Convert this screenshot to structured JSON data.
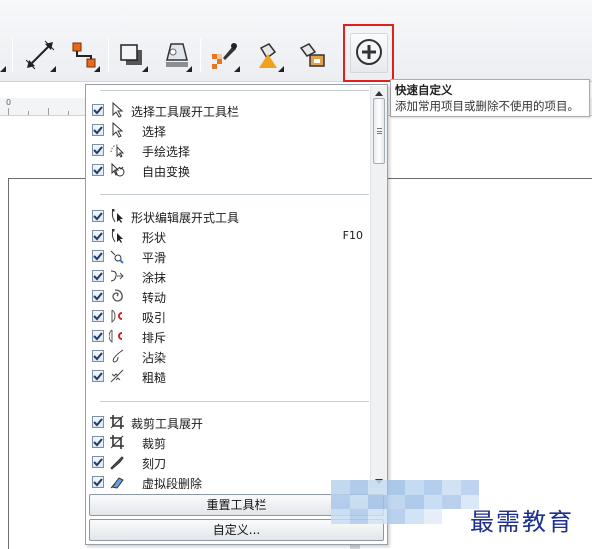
{
  "toolbar": {
    "buttons": [
      {
        "name": "tool-icon-partial",
        "icon": "partial-tool-icon"
      },
      {
        "name": "dimension-tool",
        "icon": "dimension-icon"
      },
      {
        "name": "connector-tool",
        "icon": "connector-icon"
      },
      {
        "name": "shadow-tool",
        "icon": "drop-shadow-icon"
      },
      {
        "name": "transparency-tool",
        "icon": "transparency-icon"
      },
      {
        "name": "color-eyedropper-tool",
        "icon": "eyedropper-icon"
      },
      {
        "name": "interactive-fill-tool",
        "icon": "fill-icon"
      },
      {
        "name": "smart-fill-tool",
        "icon": "smart-fill-icon"
      }
    ],
    "customize_button_icon": "plus-circle-icon"
  },
  "tooltip": {
    "title": "快速自定义",
    "description": "添加常用项目或删除不使用的项目。"
  },
  "ruler": {
    "label": "0"
  },
  "menu": {
    "groups": [
      {
        "label": "选择工具展开工具栏",
        "checked": true,
        "icon": "pick-arrow-icon",
        "items": [
          {
            "label": "选择",
            "checked": true,
            "icon": "pick-arrow-icon",
            "shortcut": ""
          },
          {
            "label": "手绘选择",
            "checked": true,
            "icon": "freehand-pick-icon",
            "shortcut": ""
          },
          {
            "label": "自由变换",
            "checked": true,
            "icon": "free-transform-icon",
            "shortcut": ""
          }
        ]
      },
      {
        "label": "形状编辑展开式工具",
        "checked": true,
        "icon": "shape-tool-icon",
        "items": [
          {
            "label": "形状",
            "checked": true,
            "icon": "shape-tool-icon",
            "shortcut": "F10"
          },
          {
            "label": "平滑",
            "checked": true,
            "icon": "smooth-icon",
            "shortcut": ""
          },
          {
            "label": "涂抹",
            "checked": true,
            "icon": "smear-icon",
            "shortcut": ""
          },
          {
            "label": "转动",
            "checked": true,
            "icon": "twirl-icon",
            "shortcut": ""
          },
          {
            "label": "吸引",
            "checked": true,
            "icon": "attract-icon",
            "shortcut": ""
          },
          {
            "label": "排斥",
            "checked": true,
            "icon": "repel-icon",
            "shortcut": ""
          },
          {
            "label": "沾染",
            "checked": true,
            "icon": "smudge-icon",
            "shortcut": ""
          },
          {
            "label": "粗糙",
            "checked": true,
            "icon": "roughen-icon",
            "shortcut": ""
          }
        ]
      },
      {
        "label": "裁剪工具展开",
        "checked": true,
        "icon": "crop-icon",
        "items": [
          {
            "label": "裁剪",
            "checked": true,
            "icon": "crop-icon",
            "shortcut": ""
          },
          {
            "label": "刻刀",
            "checked": true,
            "icon": "knife-icon",
            "shortcut": ""
          },
          {
            "label": "虚拟段删除",
            "checked": true,
            "icon": "virtual-segment-delete-icon",
            "shortcut": ""
          }
        ]
      }
    ],
    "reset_button": "重置工具栏",
    "customize_button": "自定义..."
  },
  "watermark": {
    "text": "最需教育"
  },
  "colors": {
    "highlight_border": "#e0211b",
    "menu_border": "#97a0aa",
    "checkbox_border": "#7b8fa8",
    "check_mark": "#1f3b6e",
    "watermark_text": "#1d2f8f"
  }
}
